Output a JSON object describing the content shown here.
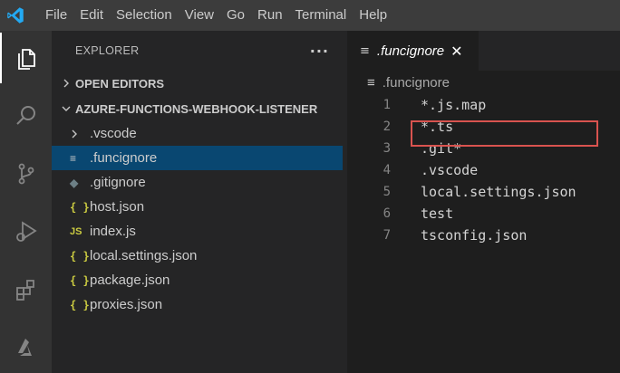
{
  "menu": [
    "File",
    "Edit",
    "Selection",
    "View",
    "Go",
    "Run",
    "Terminal",
    "Help"
  ],
  "activity_bar": [
    {
      "name": "explorer-icon",
      "active": true
    },
    {
      "name": "search-icon"
    },
    {
      "name": "source-control-icon"
    },
    {
      "name": "run-debug-icon"
    },
    {
      "name": "extensions-icon"
    },
    {
      "name": "azure-icon"
    }
  ],
  "sidebar": {
    "title": "EXPLORER",
    "more": "···",
    "open_editors": "OPEN EDITORS",
    "project": "AZURE-FUNCTIONS-WEBHOOK-LISTENER",
    "items": [
      {
        "label": ".vscode",
        "icon": "chevron-right-icon"
      },
      {
        "label": ".funcignore",
        "icon": "lines-icon",
        "selected": true
      },
      {
        "label": ".gitignore",
        "icon": "git-icon"
      },
      {
        "label": "host.json",
        "icon": "json-icon"
      },
      {
        "label": "index.js",
        "icon": "js-icon"
      },
      {
        "label": "local.settings.json",
        "icon": "json-icon"
      },
      {
        "label": "package.json",
        "icon": "json-icon"
      },
      {
        "label": "proxies.json",
        "icon": "json-icon"
      }
    ]
  },
  "editor": {
    "tab_label": ".funcignore",
    "tab_close": "✕",
    "breadcrumb": ".funcignore",
    "lines": [
      {
        "n": "1",
        "text": "*.js.map"
      },
      {
        "n": "2",
        "text": "*.ts"
      },
      {
        "n": "3",
        "text": ".git*"
      },
      {
        "n": "4",
        "text": ".vscode"
      },
      {
        "n": "5",
        "text": "local.settings.json"
      },
      {
        "n": "6",
        "text": "test"
      },
      {
        "n": "7",
        "text": "tsconfig.json"
      }
    ],
    "highlight_color": "#d9534f"
  },
  "icons": {
    "json": "{ }",
    "js": "JS",
    "git": "◆",
    "lines": "≡",
    "chevron_right": "›",
    "chevron_down": "⌄"
  }
}
